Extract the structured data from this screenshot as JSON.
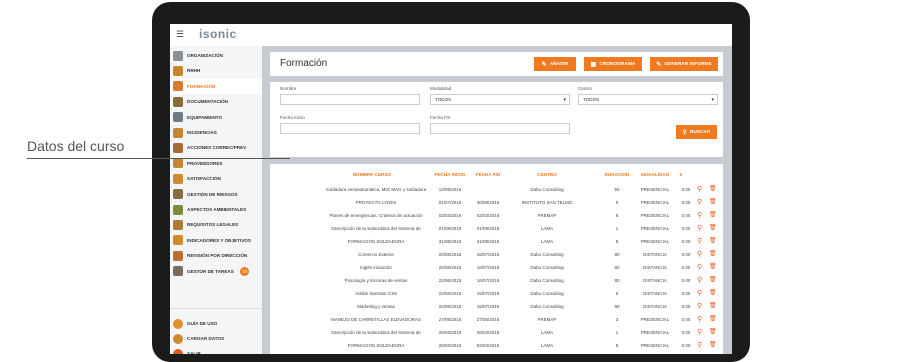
{
  "app": {
    "logo": "isonic"
  },
  "sidebar": {
    "items": [
      {
        "label": "ORGANIZACIÓN"
      },
      {
        "label": "RRHH"
      },
      {
        "label": "FORMACIÓN",
        "active": true
      },
      {
        "label": "DOCUMENTACIÓN"
      },
      {
        "label": "EQUIPAMIENTO"
      },
      {
        "label": "INCIDENCIAS"
      },
      {
        "label": "ACCIONES CORREC/PREV"
      },
      {
        "label": "PROVEEDORES"
      },
      {
        "label": "SATISFACCIÓN"
      },
      {
        "label": "GESTIÓN DE RIESGOS"
      },
      {
        "label": "ASPECTOS AMBIENTALES"
      },
      {
        "label": "REQUISITOS LEGALES"
      },
      {
        "label": "INDICADORES Y OBJETIVOS"
      },
      {
        "label": "REVISIÓN POR DIRECCIÓN"
      },
      {
        "label": "GESTOR DE TAREAS",
        "badge": "10"
      }
    ],
    "bottom": [
      {
        "label": "GUÍA DE USO"
      },
      {
        "label": "CARGAR DATOS"
      },
      {
        "label": "SALIR"
      }
    ]
  },
  "header": {
    "title": "Formación",
    "buttons": [
      "AÑADIR",
      "CRONOGRAMA",
      "GENERAR INFORME"
    ]
  },
  "filters": {
    "nombre_label": "Nombre",
    "nombre_value": "",
    "modalidad_label": "Modalidad",
    "modalidad_value": "TODOS",
    "centro_label": "Centro",
    "centro_value": "TODOS",
    "fecha_inicio_label": "Fecha Inicio",
    "fecha_inicio_value": "",
    "fecha_fin_label": "Fecha Fin",
    "fecha_fin_value": "",
    "buscar": "BUSCAR"
  },
  "table": {
    "columns": [
      "NOMBRE CURSO",
      "FECHA INICIO",
      "FECHA FIN",
      "CENTRO",
      "DURACION",
      "MODALIDAD",
      "€"
    ],
    "rows": [
      [
        "Soldadura semiautomática, MIG MAG y soldadura",
        "12/09/2016",
        "",
        "Dabo Consulting",
        "50",
        "PRESENCIAL",
        "0.00"
      ],
      [
        "PROYECTO LYDES",
        "01/07/2016",
        "30/09/2016",
        "INSTITUTO SAN TELMO",
        "0",
        "PRESENCIAL",
        "0.00"
      ],
      [
        "Planes de emergencias. Criterios de actuación",
        "02/03/2016",
        "02/03/2016",
        "FREMAP",
        "6",
        "PRESENCIAL",
        "0.00"
      ],
      [
        "Descripción de la sistemática del Sistema de",
        "01/09/2015",
        "01/09/2015",
        "LAMA",
        "1",
        "PRESENCIAL",
        "0.00"
      ],
      [
        "FORMACIÓN SOLDADURA",
        "31/08/2015",
        "31/08/2015",
        "LAMA",
        "8",
        "PRESENCIAL",
        "0.00"
      ],
      [
        "Comercio Exterior",
        "22/06/2015",
        "16/07/2015",
        "Dabo Consulting",
        "80",
        "DISTANCIA",
        "0.00"
      ],
      [
        "Inglés iniciación",
        "22/06/2015",
        "16/07/2015",
        "Dabo Consulting",
        "80",
        "DISTANCIA",
        "0.00"
      ],
      [
        "Psicología y técnicas de ventas",
        "22/06/2015",
        "16/07/2015",
        "Dabo Consulting",
        "80",
        "DISTANCIA",
        "0.00"
      ],
      [
        "Adobe Ilustrator CS6",
        "22/06/2015",
        "16/07/2015",
        "Dabo Consulting",
        "0",
        "DISTANCIA",
        "0.00"
      ],
      [
        "Marketing y ventas",
        "22/06/2015",
        "16/07/2015",
        "Dabo Consulting",
        "80",
        "DISTANCIA",
        "0.00"
      ],
      [
        "MANEJO DE CARRETILLAS ELEVADORAS",
        "27/05/2015",
        "27/05/2015",
        "FREMAP",
        "3",
        "PRESENCIAL",
        "0.00"
      ],
      [
        "Descripción de la sistemática del Sistema de",
        "26/03/2015",
        "26/03/2015",
        "LAMA",
        "1",
        "PRESENCIAL",
        "0.00"
      ],
      [
        "FORMACIÓN SOLDADURA",
        "26/03/2015",
        "02/04/2015",
        "LAMA",
        "8",
        "PRESENCIAL",
        "0.00"
      ]
    ]
  },
  "callout": {
    "text": "Datos del curso"
  },
  "colors": {
    "accent": "#f07a1f",
    "sidebar_bg": "#f4f5f6",
    "content_bg": "#c5cbd1"
  }
}
